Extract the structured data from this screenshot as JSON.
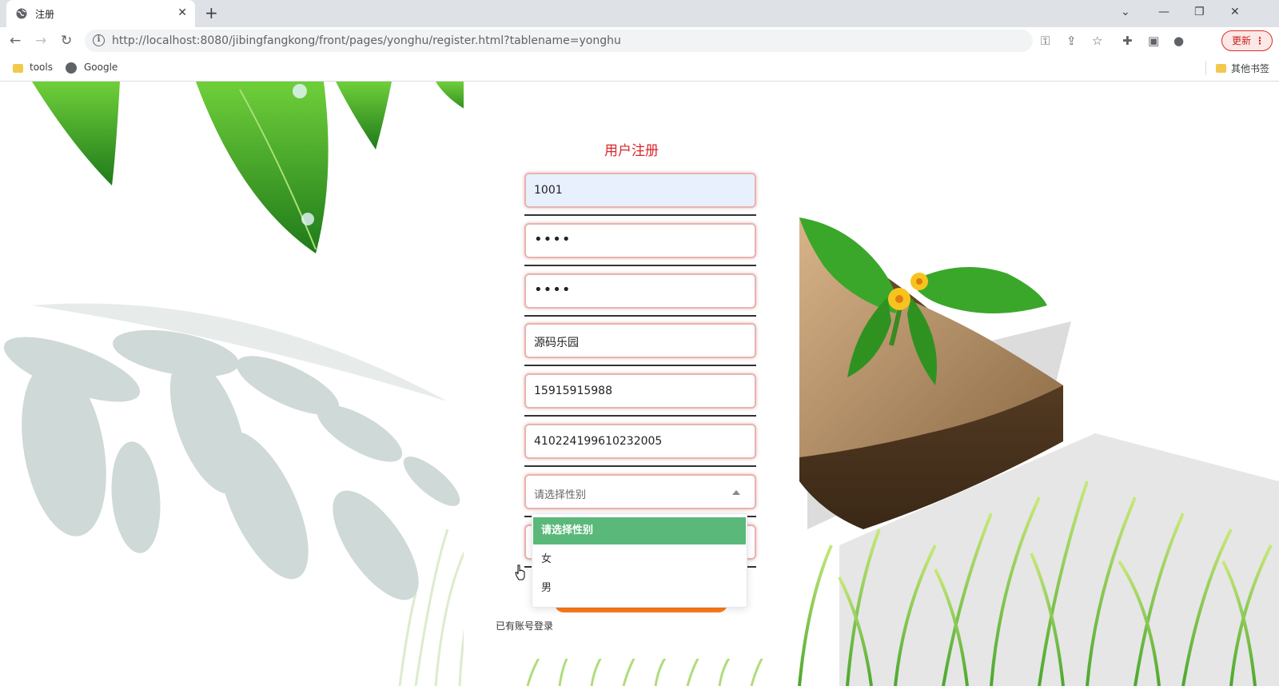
{
  "browser": {
    "tab_title": "注册",
    "url": "http://localhost:8080/jibingfangkong/front/pages/yonghu/register.html?tablename=yonghu",
    "update_label": "更新",
    "bookmarks": [
      {
        "label": "tools",
        "icon": "folder-icon"
      },
      {
        "label": "Google",
        "icon": "globe-icon"
      }
    ],
    "other_bookmarks": "其他书签"
  },
  "form": {
    "title": "用户注册",
    "fields": [
      {
        "name": "account",
        "value": "1001",
        "autofilled": true
      },
      {
        "name": "password",
        "value": "••••"
      },
      {
        "name": "confirm-password",
        "value": "••••"
      },
      {
        "name": "username",
        "value": "源码乐园"
      },
      {
        "name": "phone",
        "value": "15915915988"
      },
      {
        "name": "id-card",
        "value": "410224199610232005"
      }
    ],
    "gender_select": {
      "placeholder": "请选择性别",
      "options": [
        "请选择性别",
        "女",
        "男"
      ],
      "selected_index": 0
    },
    "login_link": "已有账号登录"
  },
  "colors": {
    "title": "#d9262c",
    "field_border": "#e8b4b0",
    "option_active": "#5ab87a",
    "submit": "#ff7a1a",
    "update_accent": "#d93025"
  }
}
